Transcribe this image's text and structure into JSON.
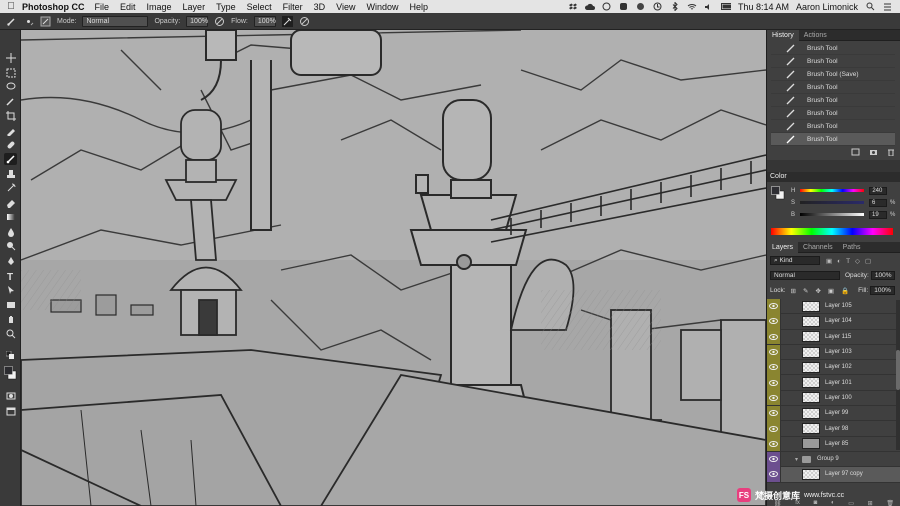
{
  "menubar": {
    "app": "Photoshop CC",
    "items": [
      "File",
      "Edit",
      "Image",
      "Layer",
      "Type",
      "Select",
      "Filter",
      "3D",
      "View",
      "Window",
      "Help"
    ],
    "clock": "Thu 8:14 AM",
    "user": "Aaron Limonick"
  },
  "options": {
    "mode_label": "Mode:",
    "mode_value": "Normal",
    "opacity_label": "Opacity:",
    "opacity_value": "100%",
    "flow_label": "Flow:",
    "flow_value": "100%"
  },
  "history": {
    "tabs": [
      "History",
      "Actions"
    ],
    "items": [
      "Brush Tool",
      "Brush Tool",
      "Brush Tool (Save)",
      "Brush Tool",
      "Brush Tool",
      "Brush Tool",
      "Brush Tool",
      "Brush Tool"
    ]
  },
  "color": {
    "title": "Color",
    "h_label": "H",
    "h_value": "240",
    "s_label": "S",
    "s_value": "6",
    "b_label": "B",
    "b_value": "19",
    "pct": "%"
  },
  "layers": {
    "tabs": [
      "Layers",
      "Channels",
      "Paths"
    ],
    "kind": "Kind",
    "blend": "Normal",
    "opacity_label": "Opacity:",
    "opacity_value": "100%",
    "lock_label": "Lock:",
    "fill_label": "Fill:",
    "fill_value": "100%",
    "items": [
      "Layer 105",
      "Layer 104",
      "Layer 115",
      "Layer 103",
      "Layer 102",
      "Layer 101",
      "Layer 100",
      "Layer 99",
      "Layer 98",
      "Layer 85",
      "Group 9",
      "Layer 97 copy"
    ],
    "footer": [
      "fx"
    ]
  },
  "watermark": {
    "badge": "FS",
    "cn": "梵摄创意库",
    "url": "www.fstvc.cc"
  },
  "colors": {
    "eye_olive": "#8a8530",
    "eye_purple": "#6c4f8f",
    "canvas_gray": "#a5a5a5",
    "ink": "#2a2a2a"
  }
}
